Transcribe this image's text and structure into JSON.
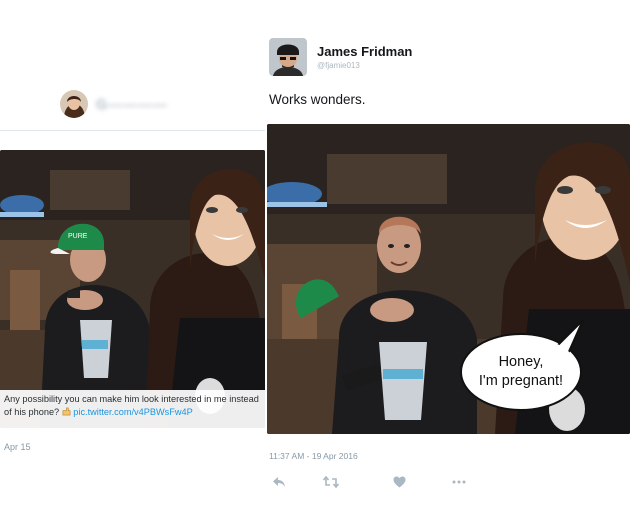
{
  "original_tweet": {
    "user_handle": "G————",
    "caption": {
      "text": "Any possibility you can make him look interested in me instead of his phone?",
      "link": "pic.twitter.com/v4PBWsFw4P"
    },
    "date": "Apr 15",
    "photo": {
      "cap_text": "PURE"
    }
  },
  "reply_tweet": {
    "author": {
      "name": "James Fridman",
      "handle": "@fjamie013"
    },
    "text": "Works wonders.",
    "photo": {
      "speech_bubble": [
        "Honey,",
        "I'm pregnant!"
      ]
    },
    "timestamp": "11:37 AM - 19 Apr 2016",
    "actions": {
      "reply_icon": "reply-icon",
      "retweet_icon": "retweet-icon",
      "like_icon": "heart-icon",
      "more_icon": "more-icon"
    }
  },
  "colors": {
    "link": "#1b95e0",
    "muted": "#8899a6",
    "icon": "#aab8c2",
    "cap_green": "#1e8a4a"
  }
}
